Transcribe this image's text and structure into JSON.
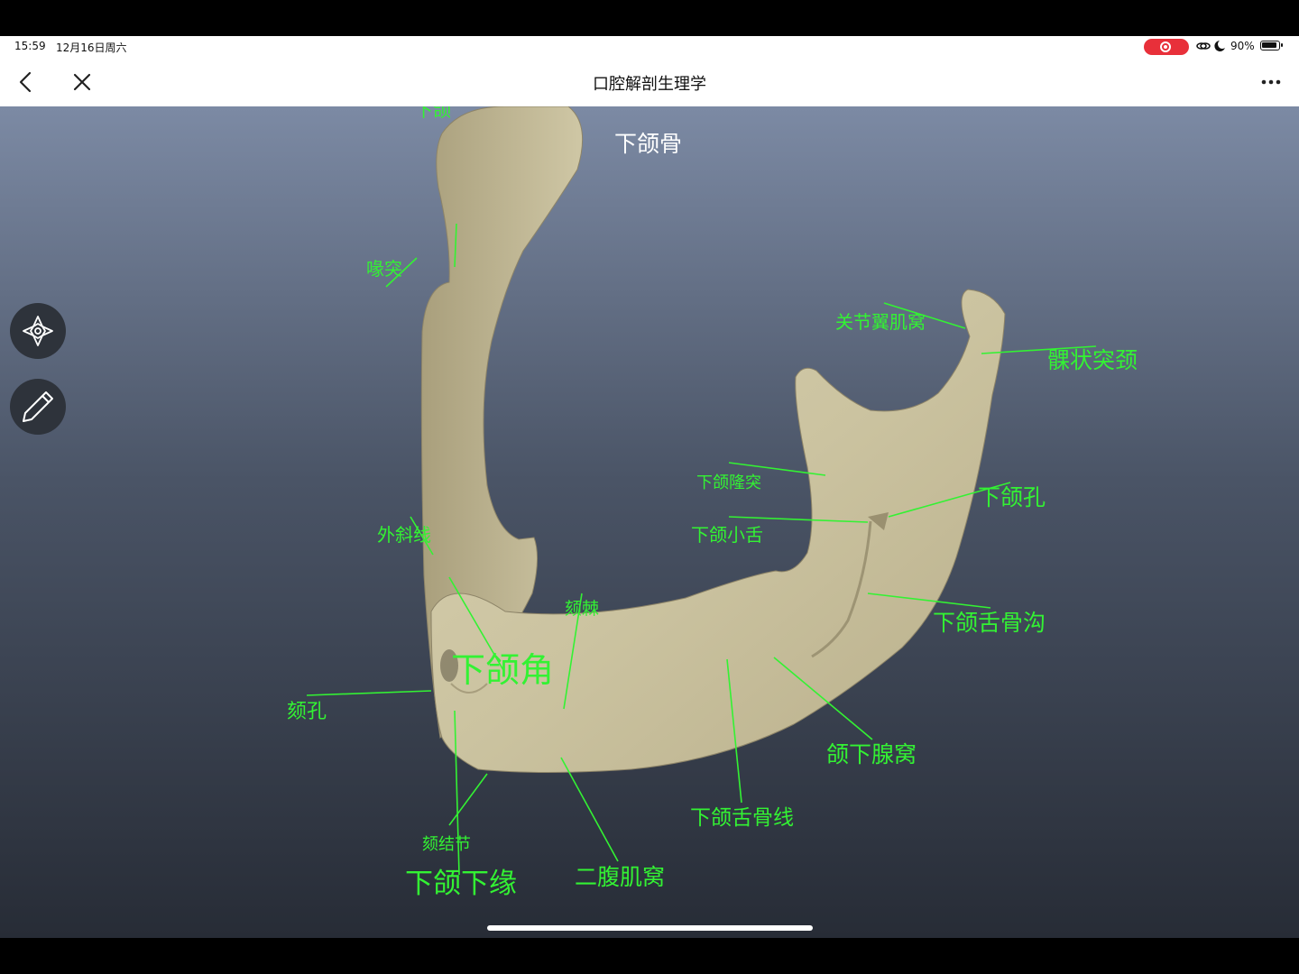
{
  "status_bar": {
    "time": "15:59",
    "date": "12月16日周六",
    "battery": "90%",
    "recording_color": "#e8303a"
  },
  "nav": {
    "title": "口腔解剖生理学",
    "back_icon": "chevron-left-icon",
    "close_icon": "close-icon",
    "more_icon": "more-dots-icon"
  },
  "viewer": {
    "model_title": "下颌骨",
    "label_color": "#33f233",
    "labels": {
      "top_cut": "下颌",
      "coronoid": "喙突",
      "pterygoid_fovea": "关节翼肌窝",
      "condyle_neck": "髁状突颈",
      "mandibular_torus": "下颌隆突",
      "mandibular_foramen": "下颌孔",
      "lingula": "下颌小舌",
      "oblique_line": "外斜线",
      "genial_spine": "颏棘",
      "mylohyoid_groove": "下颌舌骨沟",
      "mandibular_angle": "下颌角",
      "mental_foramen": "颏孔",
      "submandibular_fossa": "颌下腺窝",
      "mylohyoid_line": "下颌舌骨线",
      "mental_tubercle": "颏结节",
      "digastric_fossa": "二腹肌窝",
      "lower_border": "下颌下缘"
    },
    "tools": {
      "rotate_icon": "rotate-arrows-icon",
      "draw_icon": "pencil-icon"
    }
  }
}
